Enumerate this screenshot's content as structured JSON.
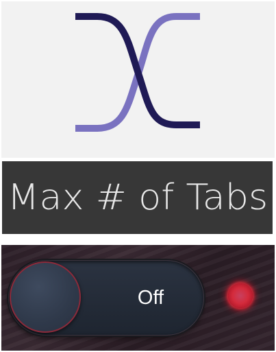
{
  "logo": {
    "icon": "crossed-curves-x-logo",
    "colors": {
      "dark_stroke": "#1f1a55",
      "light_stroke": "#7a72c0",
      "background": "#f2f2f2"
    }
  },
  "title": {
    "text": "Max # of Tabs",
    "background": "#373737"
  },
  "toggle": {
    "state_label": "Off",
    "is_on": false,
    "knob_border_color": "#8c2a3a"
  },
  "status_indicator": {
    "icon": "red-led-dot",
    "color": "#d42b3c"
  }
}
